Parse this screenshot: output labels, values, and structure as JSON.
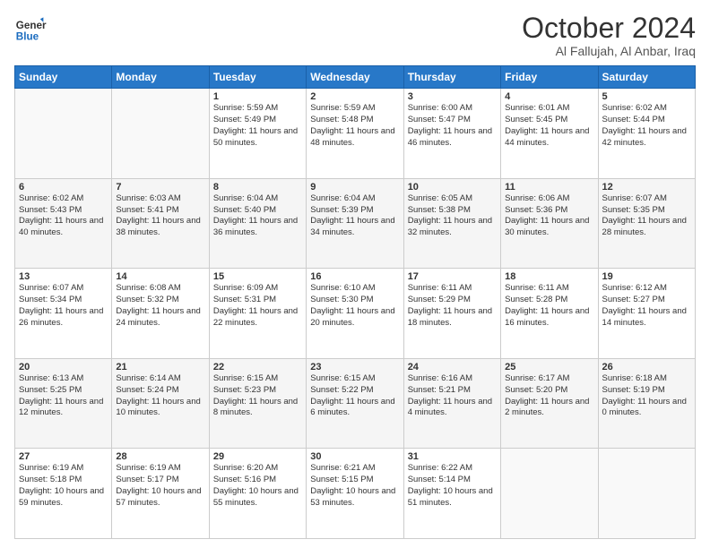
{
  "logo": {
    "general": "General",
    "blue": "Blue"
  },
  "header": {
    "month": "October 2024",
    "location": "Al Fallujah, Al Anbar, Iraq"
  },
  "weekdays": [
    "Sunday",
    "Monday",
    "Tuesday",
    "Wednesday",
    "Thursday",
    "Friday",
    "Saturday"
  ],
  "weeks": [
    [
      {
        "day": "",
        "info": ""
      },
      {
        "day": "",
        "info": ""
      },
      {
        "day": "1",
        "info": "Sunrise: 5:59 AM\nSunset: 5:49 PM\nDaylight: 11 hours and 50 minutes."
      },
      {
        "day": "2",
        "info": "Sunrise: 5:59 AM\nSunset: 5:48 PM\nDaylight: 11 hours and 48 minutes."
      },
      {
        "day": "3",
        "info": "Sunrise: 6:00 AM\nSunset: 5:47 PM\nDaylight: 11 hours and 46 minutes."
      },
      {
        "day": "4",
        "info": "Sunrise: 6:01 AM\nSunset: 5:45 PM\nDaylight: 11 hours and 44 minutes."
      },
      {
        "day": "5",
        "info": "Sunrise: 6:02 AM\nSunset: 5:44 PM\nDaylight: 11 hours and 42 minutes."
      }
    ],
    [
      {
        "day": "6",
        "info": "Sunrise: 6:02 AM\nSunset: 5:43 PM\nDaylight: 11 hours and 40 minutes."
      },
      {
        "day": "7",
        "info": "Sunrise: 6:03 AM\nSunset: 5:41 PM\nDaylight: 11 hours and 38 minutes."
      },
      {
        "day": "8",
        "info": "Sunrise: 6:04 AM\nSunset: 5:40 PM\nDaylight: 11 hours and 36 minutes."
      },
      {
        "day": "9",
        "info": "Sunrise: 6:04 AM\nSunset: 5:39 PM\nDaylight: 11 hours and 34 minutes."
      },
      {
        "day": "10",
        "info": "Sunrise: 6:05 AM\nSunset: 5:38 PM\nDaylight: 11 hours and 32 minutes."
      },
      {
        "day": "11",
        "info": "Sunrise: 6:06 AM\nSunset: 5:36 PM\nDaylight: 11 hours and 30 minutes."
      },
      {
        "day": "12",
        "info": "Sunrise: 6:07 AM\nSunset: 5:35 PM\nDaylight: 11 hours and 28 minutes."
      }
    ],
    [
      {
        "day": "13",
        "info": "Sunrise: 6:07 AM\nSunset: 5:34 PM\nDaylight: 11 hours and 26 minutes."
      },
      {
        "day": "14",
        "info": "Sunrise: 6:08 AM\nSunset: 5:32 PM\nDaylight: 11 hours and 24 minutes."
      },
      {
        "day": "15",
        "info": "Sunrise: 6:09 AM\nSunset: 5:31 PM\nDaylight: 11 hours and 22 minutes."
      },
      {
        "day": "16",
        "info": "Sunrise: 6:10 AM\nSunset: 5:30 PM\nDaylight: 11 hours and 20 minutes."
      },
      {
        "day": "17",
        "info": "Sunrise: 6:11 AM\nSunset: 5:29 PM\nDaylight: 11 hours and 18 minutes."
      },
      {
        "day": "18",
        "info": "Sunrise: 6:11 AM\nSunset: 5:28 PM\nDaylight: 11 hours and 16 minutes."
      },
      {
        "day": "19",
        "info": "Sunrise: 6:12 AM\nSunset: 5:27 PM\nDaylight: 11 hours and 14 minutes."
      }
    ],
    [
      {
        "day": "20",
        "info": "Sunrise: 6:13 AM\nSunset: 5:25 PM\nDaylight: 11 hours and 12 minutes."
      },
      {
        "day": "21",
        "info": "Sunrise: 6:14 AM\nSunset: 5:24 PM\nDaylight: 11 hours and 10 minutes."
      },
      {
        "day": "22",
        "info": "Sunrise: 6:15 AM\nSunset: 5:23 PM\nDaylight: 11 hours and 8 minutes."
      },
      {
        "day": "23",
        "info": "Sunrise: 6:15 AM\nSunset: 5:22 PM\nDaylight: 11 hours and 6 minutes."
      },
      {
        "day": "24",
        "info": "Sunrise: 6:16 AM\nSunset: 5:21 PM\nDaylight: 11 hours and 4 minutes."
      },
      {
        "day": "25",
        "info": "Sunrise: 6:17 AM\nSunset: 5:20 PM\nDaylight: 11 hours and 2 minutes."
      },
      {
        "day": "26",
        "info": "Sunrise: 6:18 AM\nSunset: 5:19 PM\nDaylight: 11 hours and 0 minutes."
      }
    ],
    [
      {
        "day": "27",
        "info": "Sunrise: 6:19 AM\nSunset: 5:18 PM\nDaylight: 10 hours and 59 minutes."
      },
      {
        "day": "28",
        "info": "Sunrise: 6:19 AM\nSunset: 5:17 PM\nDaylight: 10 hours and 57 minutes."
      },
      {
        "day": "29",
        "info": "Sunrise: 6:20 AM\nSunset: 5:16 PM\nDaylight: 10 hours and 55 minutes."
      },
      {
        "day": "30",
        "info": "Sunrise: 6:21 AM\nSunset: 5:15 PM\nDaylight: 10 hours and 53 minutes."
      },
      {
        "day": "31",
        "info": "Sunrise: 6:22 AM\nSunset: 5:14 PM\nDaylight: 10 hours and 51 minutes."
      },
      {
        "day": "",
        "info": ""
      },
      {
        "day": "",
        "info": ""
      }
    ]
  ]
}
